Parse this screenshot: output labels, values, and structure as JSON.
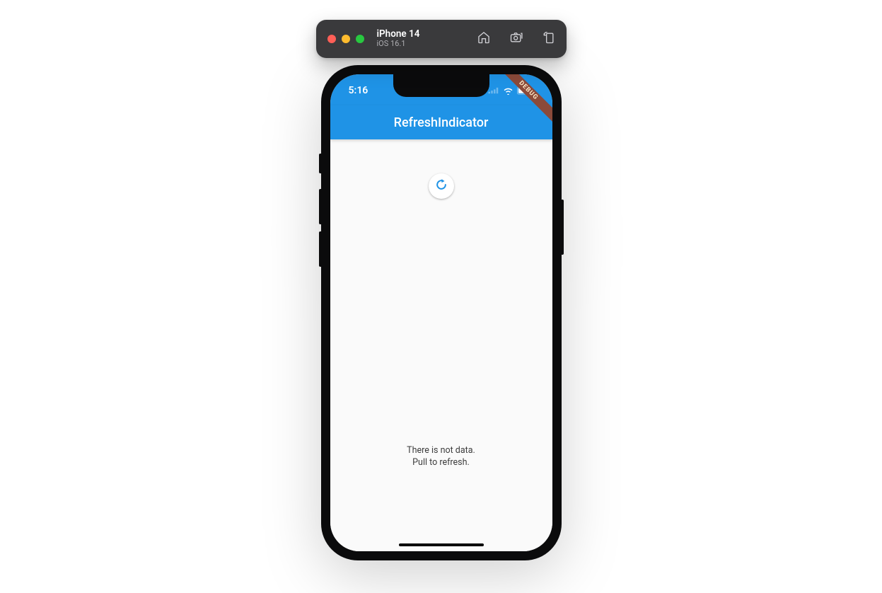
{
  "simulator": {
    "device_name": "iPhone 14",
    "os_version": "iOS 16.1"
  },
  "status_bar": {
    "time": "5:16"
  },
  "debug_banner": {
    "label": "DEBUG"
  },
  "app_bar": {
    "title": "RefreshIndicator"
  },
  "empty_state": {
    "line1": "There is not data.",
    "line2": "Pull to refresh."
  },
  "colors": {
    "primary": "#1f93e6",
    "background": "#fafafa",
    "indicator": "#1f93e6"
  }
}
